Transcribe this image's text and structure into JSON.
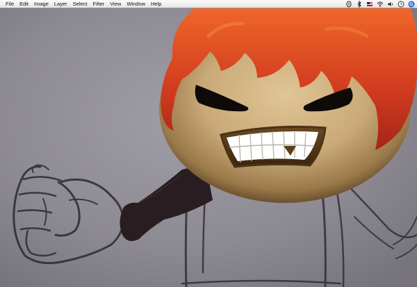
{
  "menubar": {
    "items": [
      "File",
      "Edit",
      "Image",
      "Layer",
      "Select",
      "Filter",
      "View",
      "Window",
      "Help"
    ],
    "status_icons": [
      "script-icon",
      "bluetooth-icon",
      "flag-icon",
      "wifi-icon",
      "volume-icon",
      "clock-icon",
      "spotlight-icon"
    ]
  },
  "colors": {
    "paper": "#86838b",
    "hair": "#d13b20",
    "skin": "#c7a877",
    "arm": "#2a1d22",
    "teeth": "#ffffff",
    "spotlight": "#2f6fd8"
  }
}
